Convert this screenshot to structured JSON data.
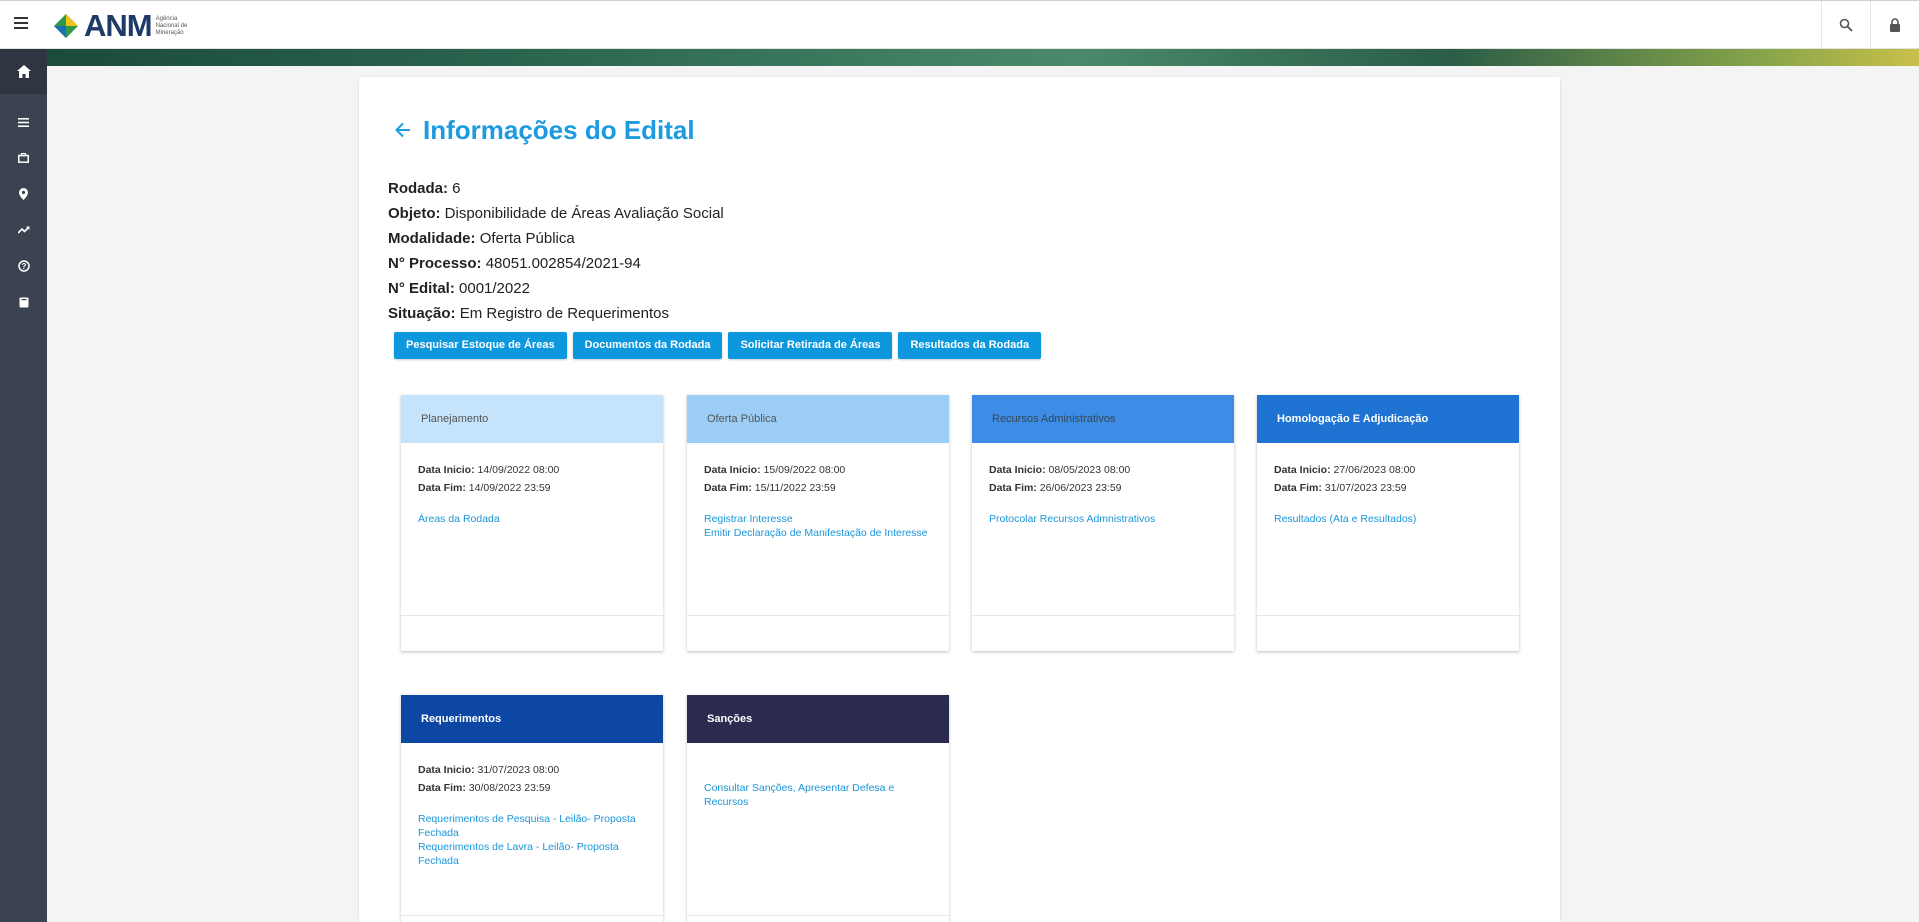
{
  "app": {
    "logo_text": "ANM",
    "logo_subtitle": "Agência Nacional de Mineração"
  },
  "colors": {
    "accent": "#1d9be0",
    "button": "#0d97dd",
    "sidebar": "#3b4250"
  },
  "topbar": {
    "icons": [
      "menu-icon",
      "search-icon",
      "lock-icon"
    ]
  },
  "sidebar": {
    "items": [
      "home-icon",
      "list-icon",
      "briefcase-icon",
      "location-pin-icon",
      "trending-up-icon",
      "help-circle-icon",
      "book-icon"
    ]
  },
  "page": {
    "title": "Informações do Edital",
    "info": [
      {
        "label": "Rodada:",
        "value": "6"
      },
      {
        "label": "Objeto:",
        "value": "Disponibilidade de Áreas Avaliação Social"
      },
      {
        "label": "Modalidade:",
        "value": "Oferta Pública"
      },
      {
        "label": "N° Processo:",
        "value": "48051.002854/2021-94"
      },
      {
        "label": "N° Edital:",
        "value": "0001/2022"
      },
      {
        "label": "Situação:",
        "value": "Em Registro de Requerimentos"
      }
    ],
    "buttons": [
      "Pesquisar Estoque de Áreas",
      "Documentos da Rodada",
      "Solicitar Retirada de Áreas",
      "Resultados da Rodada"
    ]
  },
  "phases": [
    {
      "title": "Planejamento",
      "head_color": "#c5e3fb",
      "head_text_color": "#555555",
      "start_label": "Data Inicio:",
      "start": "14/09/2022 08:00",
      "end_label": "Data Fim:",
      "end": "14/09/2022 23:59",
      "links": [
        "Áreas da Rodada"
      ]
    },
    {
      "title": "Oferta Pública",
      "head_color": "#9ccdf6",
      "head_text_color": "#555555",
      "start_label": "Data Inicio:",
      "start": "15/09/2022 08:00",
      "end_label": "Data Fim:",
      "end": "15/11/2022 23:59",
      "links": [
        "Registrar Interesse",
        "Emitir Declaração de Manifestação de Interesse"
      ]
    },
    {
      "title": "Recursos Administrativos",
      "head_color": "#3d8ce6",
      "head_text_color": "#37474f",
      "start_label": "Data Inicio:",
      "start": "08/05/2023 08:00",
      "end_label": "Data Fim:",
      "end": "26/06/2023 23:59",
      "links": [
        "Protocolar Recursos Admnistrativos"
      ]
    },
    {
      "title": "Homologação E Adjudicação",
      "head_color": "#1f73d2",
      "head_text_color": "#ffffff",
      "start_label": "Data Inicio:",
      "start": "27/06/2023 08:00",
      "end_label": "Data Fim:",
      "end": "31/07/2023 23:59",
      "links": [
        "Resultados (Ata e Resultados)"
      ]
    },
    {
      "title": "Requerimentos",
      "head_color": "#0b47a3",
      "head_text_color": "#ffffff",
      "start_label": "Data Inicio:",
      "start": "31/07/2023 08:00",
      "end_label": "Data Fim:",
      "end": "30/08/2023 23:59",
      "links": [
        "Requerimentos de Pesquisa - Leilão- Proposta Fechada",
        "Requerimentos de Lavra - Leilão- Proposta Fechada"
      ]
    },
    {
      "title": "Sanções",
      "head_color": "#2b2b52",
      "head_text_color": "#ffffff",
      "start_label": "",
      "start": "",
      "end_label": "",
      "end": "",
      "links": [
        "Consultar Sanções, Apresentar Defesa e Recursos"
      ]
    }
  ]
}
